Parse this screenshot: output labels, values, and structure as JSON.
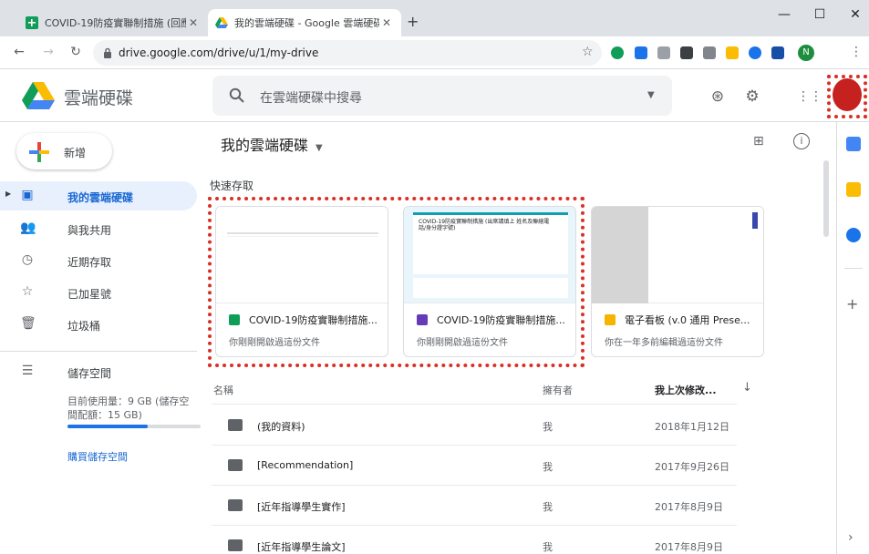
{
  "browser": {
    "tabs": [
      {
        "title": "COVID-19防疫實聯制措施 (回應)",
        "active": false
      },
      {
        "title": "我的雲端硬碟 - Google 雲端硬碟",
        "active": true
      }
    ],
    "new_tab": "+",
    "url": "drive.google.com/drive/u/1/my-drive",
    "profile_initial": "N"
  },
  "header": {
    "app_name": "雲端硬碟",
    "search_placeholder": "在雲端硬碟中搜尋"
  },
  "sidebar": {
    "new_label": "新增",
    "items": [
      {
        "label": "我的雲端硬碟",
        "icon": "my-drive-icon",
        "active": true
      },
      {
        "label": "與我共用",
        "icon": "shared-icon",
        "active": false
      },
      {
        "label": "近期存取",
        "icon": "clock-icon",
        "active": false
      },
      {
        "label": "已加星號",
        "icon": "star-icon",
        "active": false
      },
      {
        "label": "垃圾桶",
        "icon": "trash-icon",
        "active": false
      }
    ],
    "storage": {
      "label": "儲存空間",
      "usage_line1": "目前使用量：9 GB (儲存空",
      "usage_line2": "間配額：15 GB)",
      "used_fraction": 0.6,
      "buy_label": "購買儲存空間"
    }
  },
  "main": {
    "title": "我的雲端硬碟",
    "quick_access_label": "快速存取",
    "cards": [
      {
        "name": "COVID-19防疫實聯制措施...",
        "subtitle": "你剛剛開啟過這份文件",
        "type": "sheets",
        "color": "#0f9d58"
      },
      {
        "name": "COVID-19防疫實聯制措施...",
        "subtitle": "你剛剛開啟過這份文件",
        "type": "forms",
        "color": "#673ab7"
      },
      {
        "name": "電子看板 (v.0 通用 Prese...",
        "subtitle": "你在一年多前編輯過這份文件",
        "type": "slides",
        "color": "#f4b400"
      }
    ],
    "form_preview_title": "COVID-19防疫實聯制措施 (出席請填上 姓名及聯絡電話/身分證字號)",
    "list_header": {
      "name": "名稱",
      "owner": "擁有者",
      "modified": "我上次修改..."
    },
    "rows": [
      {
        "name": "(我的資料)",
        "owner": "我",
        "modified": "2018年1月12日",
        "shared": false
      },
      {
        "name": "[Recommendation]",
        "owner": "我",
        "modified": "2017年9月26日",
        "shared": false
      },
      {
        "name": "[近年指導學生實作]",
        "owner": "我",
        "modified": "2017年8月9日",
        "shared": false
      },
      {
        "name": "[近年指導學生論文]",
        "owner": "我",
        "modified": "2017年8月9日",
        "shared": true
      }
    ]
  },
  "colors": {
    "accent": "#1967d2",
    "highlight": "#d93025"
  }
}
